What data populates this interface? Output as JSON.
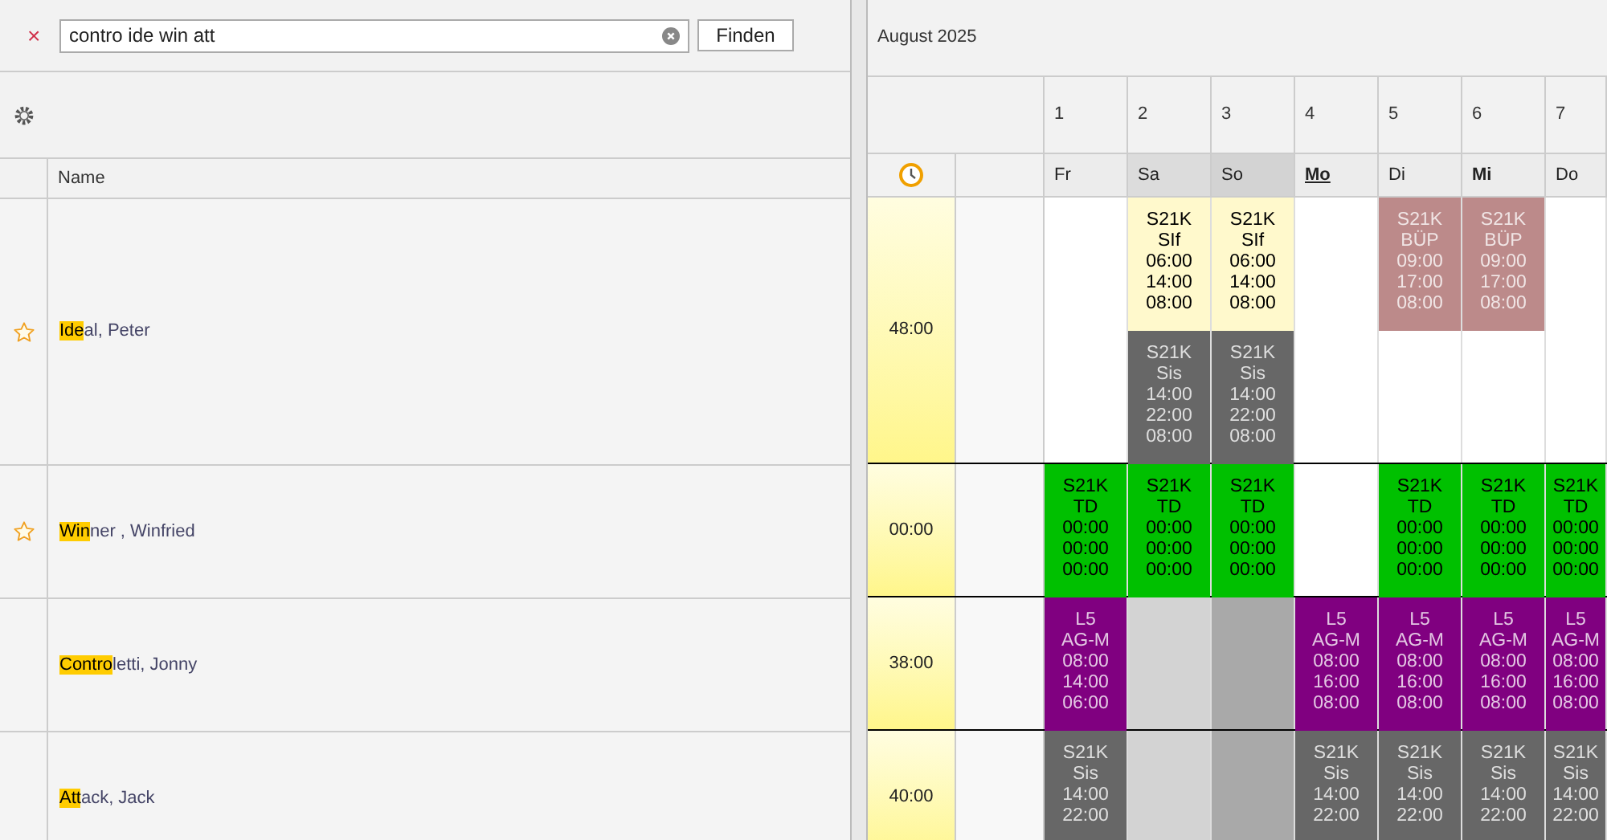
{
  "search": {
    "clear_mark": "×",
    "value": "contro ide win att",
    "button": "Finden"
  },
  "list": {
    "column": "Name",
    "rows": [
      {
        "match": "Ide",
        "rest": "al, Peter",
        "starred": true
      },
      {
        "match": "Win",
        "rest": "ner , Winfried",
        "starred": true
      },
      {
        "match": "Contro",
        "rest": "letti, Jonny",
        "starred": false
      },
      {
        "match": "Att",
        "rest": "ack, Jack",
        "starred": false
      }
    ]
  },
  "calendar": {
    "month": "August 2025",
    "days": [
      {
        "number": "1",
        "weekday": "Fr",
        "kind": "plain"
      },
      {
        "number": "2",
        "weekday": "Sa",
        "kind": "weekend"
      },
      {
        "number": "3",
        "weekday": "So",
        "kind": "sunday"
      },
      {
        "number": "4",
        "weekday": "Mo",
        "kind": "today"
      },
      {
        "number": "5",
        "weekday": "Di",
        "kind": "plain"
      },
      {
        "number": "6",
        "weekday": "Mi",
        "kind": "bold"
      },
      {
        "number": "7",
        "weekday": "Do",
        "kind": "plain"
      }
    ],
    "rows": [
      {
        "hours": "48:00",
        "cells": [
          {
            "color": "#ffffff"
          },
          {
            "shifts": [
              {
                "color": "#fff9cc",
                "kind": "dark",
                "lines": [
                  "S21K",
                  "SIf",
                  "06:00",
                  "14:00",
                  "08:00"
                ]
              },
              {
                "color": "#676767",
                "kind": "light",
                "lines": [
                  "S21K",
                  "Sis",
                  "14:00",
                  "22:00",
                  "08:00"
                ]
              }
            ]
          },
          {
            "shifts": [
              {
                "color": "#fff9cc",
                "kind": "dark",
                "lines": [
                  "S21K",
                  "SIf",
                  "06:00",
                  "14:00",
                  "08:00"
                ]
              },
              {
                "color": "#676767",
                "kind": "light",
                "lines": [
                  "S21K",
                  "Sis",
                  "14:00",
                  "22:00",
                  "08:00"
                ]
              }
            ]
          },
          {
            "color": "#ffffff"
          },
          {
            "shifts": [
              {
                "color": "#bc8a8a",
                "kind": "light",
                "lines": [
                  "S21K",
                  "BÜP",
                  "09:00",
                  "17:00",
                  "08:00"
                ]
              }
            ]
          },
          {
            "shifts": [
              {
                "color": "#bc8a8a",
                "kind": "light",
                "lines": [
                  "S21K",
                  "BÜP",
                  "09:00",
                  "17:00",
                  "08:00"
                ]
              }
            ]
          },
          {
            "color": "#ffffff"
          }
        ]
      },
      {
        "hours": "00:00",
        "cells": [
          {
            "shifts": [
              {
                "color": "#00c000",
                "kind": "dark",
                "lines": [
                  "S21K",
                  "TD",
                  "00:00",
                  "00:00",
                  "00:00"
                ]
              }
            ]
          },
          {
            "shifts": [
              {
                "color": "#00c000",
                "kind": "dark",
                "lines": [
                  "S21K",
                  "TD",
                  "00:00",
                  "00:00",
                  "00:00"
                ]
              }
            ]
          },
          {
            "shifts": [
              {
                "color": "#00c000",
                "kind": "dark",
                "lines": [
                  "S21K",
                  "TD",
                  "00:00",
                  "00:00",
                  "00:00"
                ]
              }
            ]
          },
          {
            "color": "#ffffff"
          },
          {
            "shifts": [
              {
                "color": "#00c000",
                "kind": "dark",
                "lines": [
                  "S21K",
                  "TD",
                  "00:00",
                  "00:00",
                  "00:00"
                ]
              }
            ]
          },
          {
            "shifts": [
              {
                "color": "#00c000",
                "kind": "dark",
                "lines": [
                  "S21K",
                  "TD",
                  "00:00",
                  "00:00",
                  "00:00"
                ]
              }
            ]
          },
          {
            "shifts": [
              {
                "color": "#00c000",
                "kind": "dark",
                "lines": [
                  "S21K",
                  "TD",
                  "00:00",
                  "00:00",
                  "00:00"
                ]
              }
            ]
          }
        ]
      },
      {
        "hours": "38:00",
        "cells": [
          {
            "shifts": [
              {
                "color": "#800080",
                "kind": "light",
                "lines": [
                  "L5",
                  "AG-M",
                  "08:00",
                  "14:00",
                  "06:00"
                ]
              }
            ]
          },
          {
            "color": "#d3d3d3"
          },
          {
            "color": "#a9a9a9"
          },
          {
            "shifts": [
              {
                "color": "#800080",
                "kind": "light",
                "lines": [
                  "L5",
                  "AG-M",
                  "08:00",
                  "16:00",
                  "08:00"
                ]
              }
            ]
          },
          {
            "shifts": [
              {
                "color": "#800080",
                "kind": "light",
                "lines": [
                  "L5",
                  "AG-M",
                  "08:00",
                  "16:00",
                  "08:00"
                ]
              }
            ]
          },
          {
            "shifts": [
              {
                "color": "#800080",
                "kind": "light",
                "lines": [
                  "L5",
                  "AG-M",
                  "08:00",
                  "16:00",
                  "08:00"
                ]
              }
            ]
          },
          {
            "shifts": [
              {
                "color": "#800080",
                "kind": "light",
                "lines": [
                  "L5",
                  "AG-M",
                  "08:00",
                  "16:00",
                  "08:00"
                ]
              }
            ]
          }
        ]
      },
      {
        "hours": "40:00",
        "cells": [
          {
            "shifts": [
              {
                "color": "#676767",
                "kind": "light",
                "lines": [
                  "S21K",
                  "Sis",
                  "14:00",
                  "22:00"
                ]
              }
            ]
          },
          {
            "color": "#d3d3d3"
          },
          {
            "color": "#a9a9a9"
          },
          {
            "shifts": [
              {
                "color": "#676767",
                "kind": "light",
                "lines": [
                  "S21K",
                  "Sis",
                  "14:00",
                  "22:00"
                ]
              }
            ]
          },
          {
            "shifts": [
              {
                "color": "#676767",
                "kind": "light",
                "lines": [
                  "S21K",
                  "Sis",
                  "14:00",
                  "22:00"
                ]
              }
            ]
          },
          {
            "shifts": [
              {
                "color": "#676767",
                "kind": "light",
                "lines": [
                  "S21K",
                  "Sis",
                  "14:00",
                  "22:00"
                ]
              }
            ]
          },
          {
            "shifts": [
              {
                "color": "#676767",
                "kind": "light",
                "lines": [
                  "S21K",
                  "Sis",
                  "14:00",
                  "22:00"
                ]
              }
            ]
          }
        ]
      }
    ]
  }
}
